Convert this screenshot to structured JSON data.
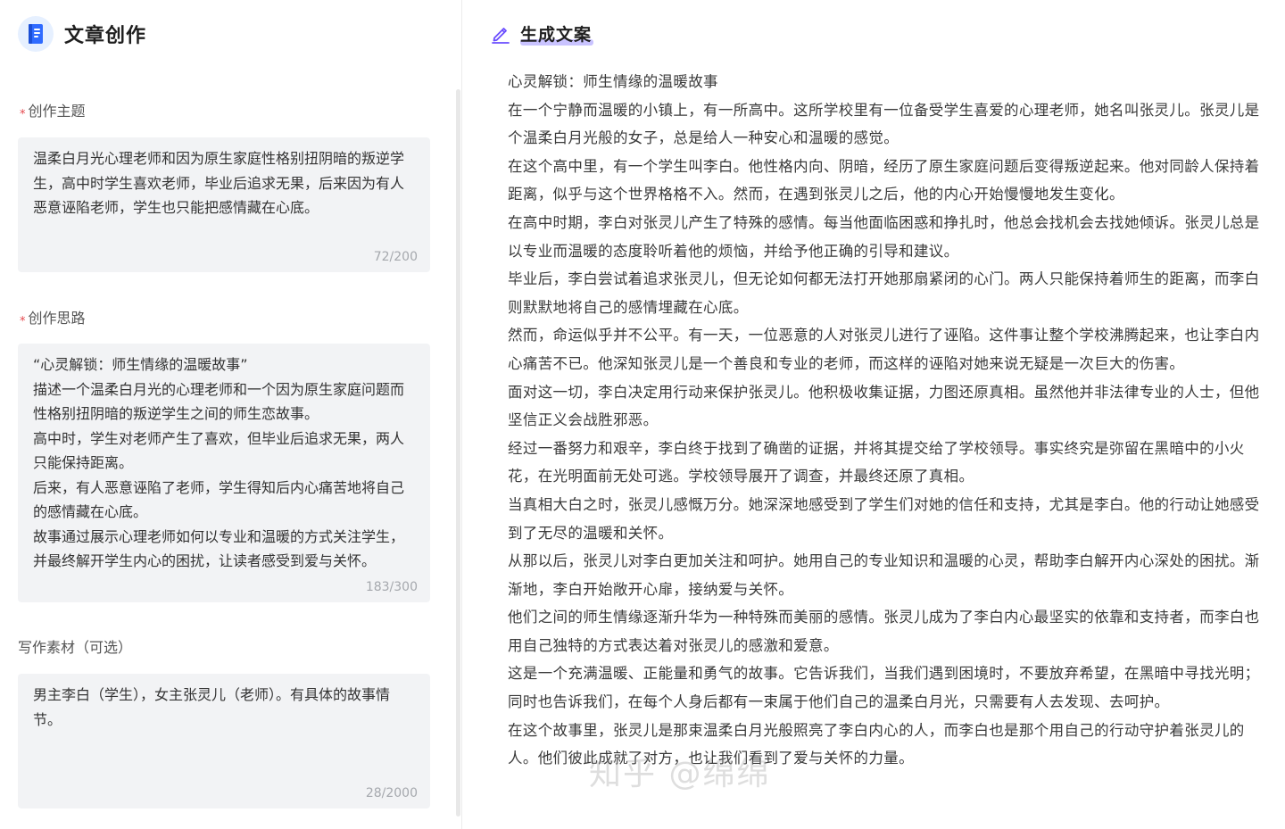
{
  "left": {
    "title": "文章创作",
    "fields": [
      {
        "label": "创作主题",
        "required": "*",
        "value": "温柔白月光心理老师和因为原生家庭性格别扭阴暗的叛逆学生，高中时学生喜欢老师，毕业后追求无果，后来因为有人恶意诬陷老师，学生也只能把感情藏在心底。",
        "counter": "72/200"
      },
      {
        "label": "创作思路",
        "required": "*",
        "value": "“心灵解锁：师生情缘的温暖故事”\n描述一个温柔白月光的心理老师和一个因为原生家庭问题而性格别扭阴暗的叛逆学生之间的师生恋故事。\n高中时，学生对老师产生了喜欢，但毕业后追求无果，两人只能保持距离。\n后来，有人恶意诬陷了老师，学生得知后内心痛苦地将自己的感情藏在心底。\n故事通过展示心理老师如何以专业和温暖的方式关注学生，并最终解开学生内心的困扰，让读者感受到爱与关怀。",
        "counter": "183/300"
      },
      {
        "label": "写作素材（可选）",
        "value": "男主李白（学生），女主张灵儿（老师）。有具体的故事情节。",
        "counter": "28/2000"
      }
    ]
  },
  "right": {
    "title": "生成文案",
    "paragraphs": [
      "心灵解锁：师生情缘的温暖故事",
      "在一个宁静而温暖的小镇上，有一所高中。这所学校里有一位备受学生喜爱的心理老师，她名叫张灵儿。张灵儿是个温柔白月光般的女子，总是给人一种安心和温暖的感觉。",
      "在这个高中里，有一个学生叫李白。他性格内向、阴暗，经历了原生家庭问题后变得叛逆起来。他对同龄人保持着距离，似乎与这个世界格格不入。然而，在遇到张灵儿之后，他的内心开始慢慢地发生变化。",
      "在高中时期，李白对张灵儿产生了特殊的感情。每当他面临困惑和挣扎时，他总会找机会去找她倾诉。张灵儿总是以专业而温暖的态度聆听着他的烦恼，并给予他正确的引导和建议。",
      "毕业后，李白尝试着追求张灵儿，但无论如何都无法打开她那扇紧闭的心门。两人只能保持着师生的距离，而李白则默默地将自己的感情埋藏在心底。",
      "然而，命运似乎并不公平。有一天，一位恶意的人对张灵儿进行了诬陷。这件事让整个学校沸腾起来，也让李白内心痛苦不已。他深知张灵儿是一个善良和专业的老师，而这样的诬陷对她来说无疑是一次巨大的伤害。",
      "面对这一切，李白决定用行动来保护张灵儿。他积极收集证据，力图还原真相。虽然他并非法律专业的人士，但他坚信正义会战胜邪恶。",
      "经过一番努力和艰辛，李白终于找到了确凿的证据，并将其提交给了学校领导。事实终究是弥留在黑暗中的小火花，在光明面前无处可逃。学校领导展开了调查，并最终还原了真相。",
      "当真相大白之时，张灵儿感慨万分。她深深地感受到了学生们对她的信任和支持，尤其是李白。他的行动让她感受到了无尽的温暖和关怀。",
      "从那以后，张灵儿对李白更加关注和呵护。她用自己的专业知识和温暖的心灵，帮助李白解开内心深处的困扰。渐渐地，李白开始敞开心扉，接纳爱与关怀。",
      "他们之间的师生情缘逐渐升华为一种特殊而美丽的感情。张灵儿成为了李白内心最坚实的依靠和支持者，而李白也用自己独特的方式表达着对张灵儿的感激和爱意。",
      "这是一个充满温暖、正能量和勇气的故事。它告诉我们，当我们遇到困境时，不要放弃希望，在黑暗中寻找光明；同时也告诉我们，在每个人身后都有一束属于他们自己的温柔白月光，只需要有人去发现、去呵护。",
      "在这个故事里，张灵儿是那束温柔白月光般照亮了李白内心的人，而李白也是那个用自己的行动守护着张灵儿的人。他们彼此成就了对方，也让我们看到了爱与关怀的力量。"
    ]
  },
  "watermark": "知乎 @绵绵",
  "colors": {
    "accent": "#2f6bff",
    "title_highlight": "#c9c3ff",
    "required_star": "#e5484d",
    "textbox_bg": "#f2f3f5",
    "pencil_icon": "#6a4cff"
  },
  "icons": {
    "app_icon": "book-icon",
    "header_icon": "pencil-icon"
  }
}
